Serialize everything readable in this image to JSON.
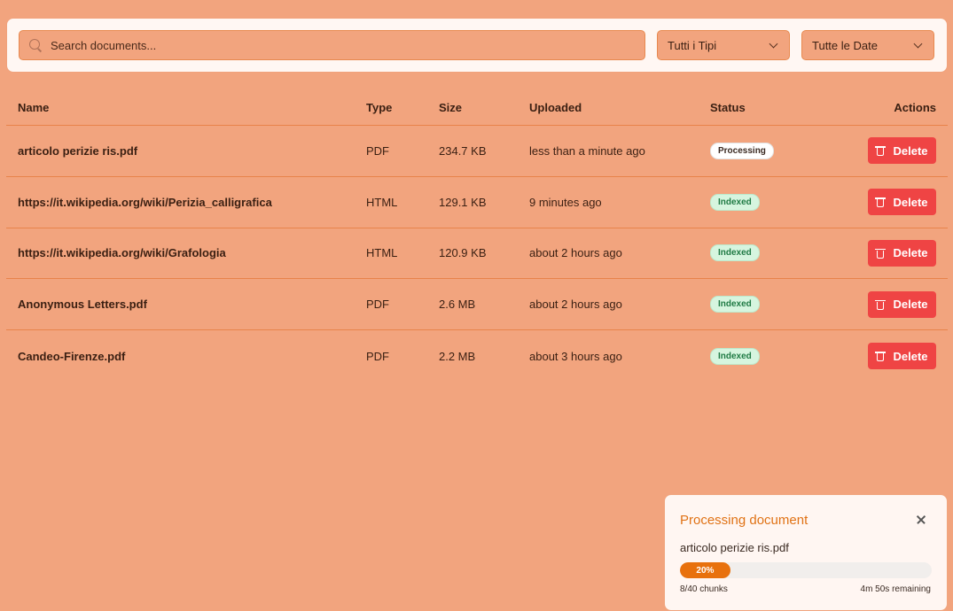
{
  "toolbar": {
    "search_placeholder": "Search documents...",
    "type_filter": "Tutti i Tipi",
    "date_filter": "Tutte le Date"
  },
  "table": {
    "headers": [
      "Name",
      "Type",
      "Size",
      "Uploaded",
      "Status",
      "Actions"
    ],
    "rows": [
      {
        "name": "articolo perizie ris.pdf",
        "type": "PDF",
        "size": "234.7 KB",
        "uploaded": "less than a minute ago",
        "status": "Processing",
        "action": "Delete"
      },
      {
        "name": "https://it.wikipedia.org/wiki/Perizia_calligrafica",
        "type": "HTML",
        "size": "129.1 KB",
        "uploaded": "9 minutes ago",
        "status": "Indexed",
        "action": "Delete"
      },
      {
        "name": "https://it.wikipedia.org/wiki/Grafologia",
        "type": "HTML",
        "size": "120.9 KB",
        "uploaded": "about 2 hours ago",
        "status": "Indexed",
        "action": "Delete"
      },
      {
        "name": "Anonymous Letters.pdf",
        "type": "PDF",
        "size": "2.6 MB",
        "uploaded": "about 2 hours ago",
        "status": "Indexed",
        "action": "Delete"
      },
      {
        "name": "Candeo-Firenze.pdf",
        "type": "PDF",
        "size": "2.2 MB",
        "uploaded": "about 3 hours ago",
        "status": "Indexed",
        "action": "Delete"
      }
    ]
  },
  "toast": {
    "title": "Processing document",
    "file": "articolo perizie ris.pdf",
    "progress_percent": 20,
    "progress_label": "20%",
    "chunks": "8/40 chunks",
    "remaining": "4m 50s remaining"
  },
  "colors": {
    "background": "#f2a47e",
    "delete": "#ef4444",
    "accent": "#e8710d",
    "indexed_bg": "#d6f5df",
    "indexed_text": "#1f7a44"
  }
}
